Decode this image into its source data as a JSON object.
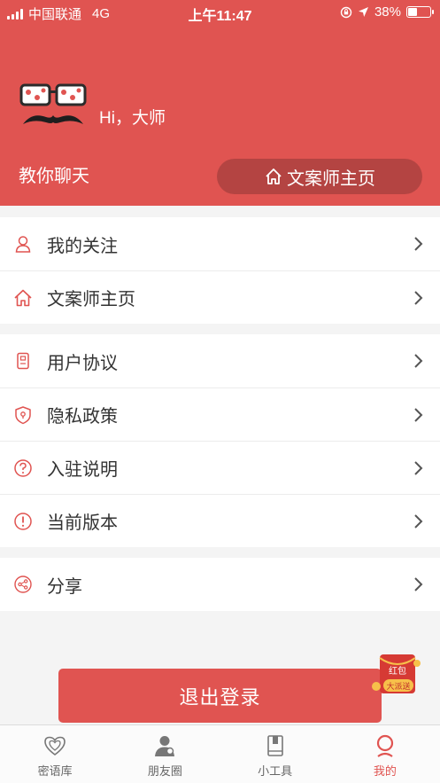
{
  "status_bar": {
    "carrier": "中国联通",
    "network": "4G",
    "time": "上午11:47",
    "battery": "38%"
  },
  "profile": {
    "greeting": "Hi，大师",
    "subtitle": "教你聊天",
    "home_button": "文案师主页"
  },
  "menu_groups": [
    {
      "items": [
        {
          "label": "我的关注",
          "icon": "user-icon"
        },
        {
          "label": "文案师主页",
          "icon": "home-icon"
        }
      ]
    },
    {
      "items": [
        {
          "label": "用户协议",
          "icon": "document-icon"
        },
        {
          "label": "隐私政策",
          "icon": "shield-icon"
        },
        {
          "label": "入驻说明",
          "icon": "question-icon"
        },
        {
          "label": "当前版本",
          "icon": "info-icon"
        }
      ]
    },
    {
      "items": [
        {
          "label": "分享",
          "icon": "share-icon"
        }
      ]
    }
  ],
  "logout_label": "退出登录",
  "red_packet": {
    "line1": "红包",
    "line2": "大派送"
  },
  "tabs": [
    {
      "label": "密语库",
      "icon": "hearts-icon",
      "active": false
    },
    {
      "label": "朋友圈",
      "icon": "person-icon",
      "active": false
    },
    {
      "label": "小工具",
      "icon": "book-icon",
      "active": false
    },
    {
      "label": "我的",
      "icon": "profile-icon",
      "active": true
    }
  ],
  "colors": {
    "accent": "#e05451",
    "pill": "#b44442",
    "icon_stroke": "#e05451",
    "tab_inactive": "#666666"
  }
}
